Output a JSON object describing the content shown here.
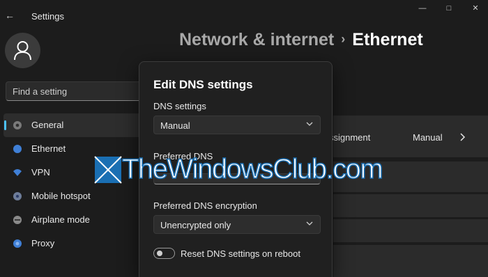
{
  "window": {
    "app_title": "Settings",
    "back_icon": "arrow-left-icon",
    "controls": [
      "minimize-icon",
      "maximize-icon",
      "close-icon"
    ]
  },
  "sidebar": {
    "search_placeholder": "Find a setting",
    "items": [
      {
        "label": "General",
        "icon": "general-icon",
        "active": true
      },
      {
        "label": "Ethernet",
        "icon": "ethernet-icon",
        "active": false
      },
      {
        "label": "VPN",
        "icon": "vpn-icon",
        "active": false
      },
      {
        "label": "Mobile hotspot",
        "icon": "hotspot-icon",
        "active": false
      },
      {
        "label": "Airplane mode",
        "icon": "airplane-icon",
        "active": false
      },
      {
        "label": "Proxy",
        "icon": "proxy-icon",
        "active": false
      }
    ]
  },
  "header": {
    "breadcrumb_parent": "Network & internet",
    "breadcrumb_separator": "›",
    "breadcrumb_current": "Ethernet"
  },
  "background_content": {
    "row1_label_partial": "ssignment",
    "row1_value": "Manual"
  },
  "dialog": {
    "title": "Edit DNS settings",
    "dns_settings_label": "DNS settings",
    "dns_settings_value": "Manual",
    "preferred_dns_label": "Preferred DNS",
    "preferred_dns_encryption_label": "Preferred DNS encryption",
    "preferred_dns_encryption_value": "Unencrypted only",
    "reset_toggle_label": "Reset DNS settings on reboot",
    "reset_toggle_on": false
  },
  "watermark": {
    "text": "TheWindowsClub.com"
  },
  "colors": {
    "accent": "#4cc2ff",
    "background": "#1c1c1c",
    "dialog_bg": "#202020",
    "watermark_blue": "#1a6fb3"
  }
}
